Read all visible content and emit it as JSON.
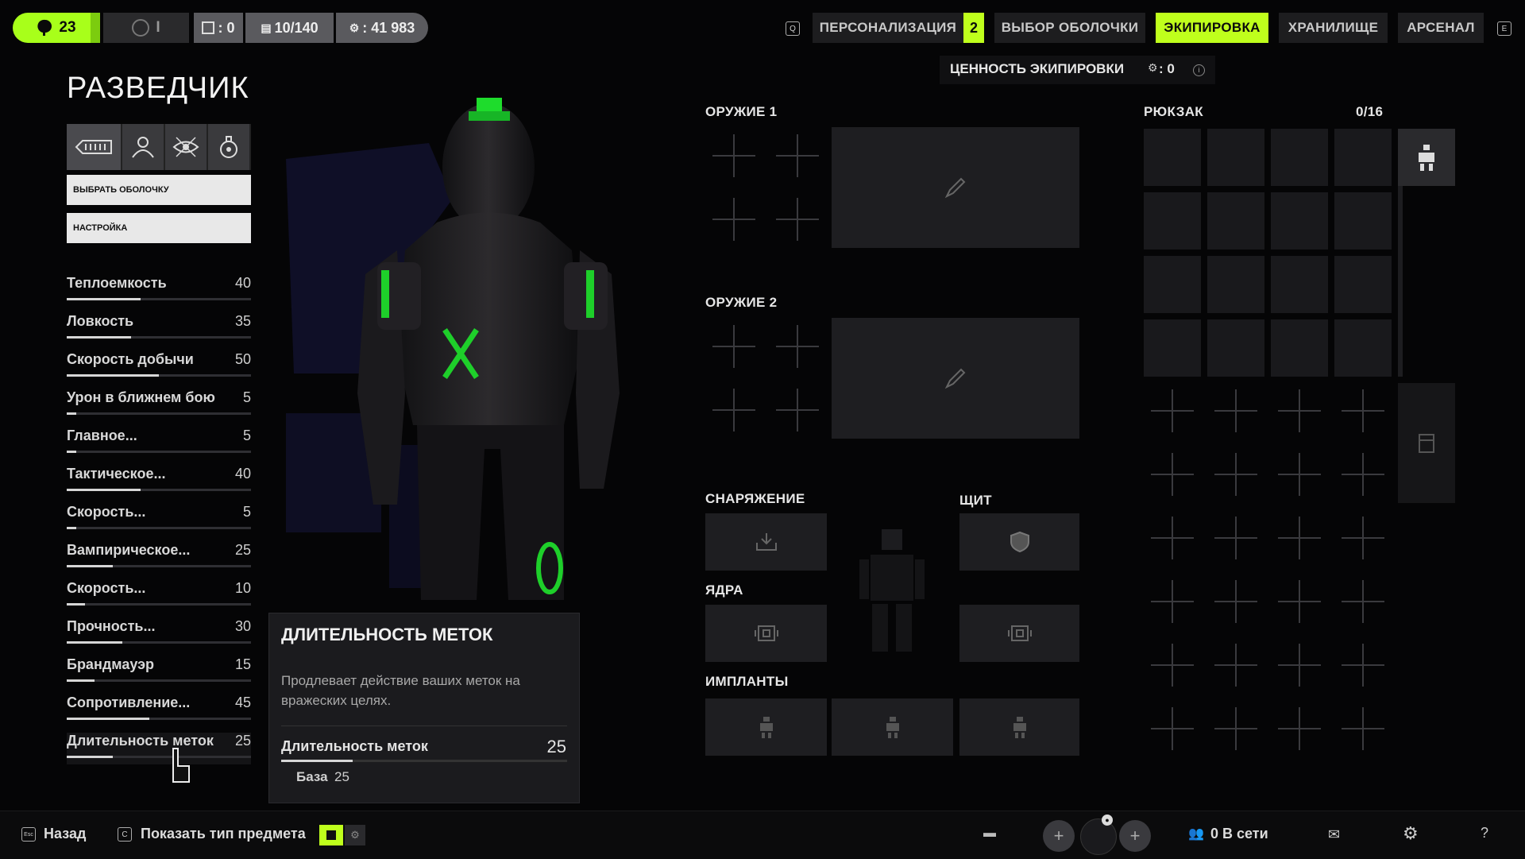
{
  "topbar": {
    "level": "23",
    "counter_2": "I",
    "currency_1": ": 0",
    "currency_2": "10/140",
    "currency_3": ": 41 983",
    "tabs": [
      {
        "label": "ПЕРСОНАЛИЗАЦИЯ",
        "active": false
      },
      {
        "label": "ВЫБОР ОБОЛОЧКИ",
        "active": false
      },
      {
        "label": "ЭКИПИРОВКА",
        "active": true
      },
      {
        "label": "ХРАНИЛИЩЕ",
        "active": false
      },
      {
        "label": "АРСЕНАЛ",
        "active": false
      }
    ],
    "personalization_badge": "2",
    "key_left": "Q",
    "key_right": "E",
    "accent": "#bfff1c"
  },
  "character": {
    "name": "РАЗВЕДЧИК",
    "select_shell_button": "ВЫБРАТЬ ОБОЛОЧКУ",
    "settings_button": "НАСТРОЙКА",
    "ability_icons": [
      "weapon-icon",
      "squad-icon",
      "recon-eye-icon",
      "grenade-icon"
    ]
  },
  "stats": [
    {
      "name": "Теплоемкость",
      "value": "40",
      "fraction": 0.4
    },
    {
      "name": "Ловкость",
      "value": "35",
      "fraction": 0.35
    },
    {
      "name": "Скорость добычи",
      "value": "50",
      "fraction": 0.5
    },
    {
      "name": "Урон в ближнем бою",
      "value": "5",
      "fraction": 0.05
    },
    {
      "name": "Главное...",
      "value": "5",
      "fraction": 0.05
    },
    {
      "name": "Тактическое...",
      "value": "40",
      "fraction": 0.4
    },
    {
      "name": "Скорость...",
      "value": "5",
      "fraction": 0.05
    },
    {
      "name": "Вампирическое...",
      "value": "25",
      "fraction": 0.25
    },
    {
      "name": "Скорость...",
      "value": "10",
      "fraction": 0.1
    },
    {
      "name": "Прочность...",
      "value": "30",
      "fraction": 0.3
    },
    {
      "name": "Брандмауэр",
      "value": "15",
      "fraction": 0.15
    },
    {
      "name": "Сопротивление...",
      "value": "45",
      "fraction": 0.45
    },
    {
      "name": "Длительность меток",
      "value": "25",
      "fraction": 0.25
    }
  ],
  "tooltip": {
    "title": "ДЛИТЕЛЬНОСТЬ МЕТОК",
    "description": "Продлевает действие ваших меток на вражеских целях.",
    "stat_name": "Длительность меток",
    "stat_value": "25",
    "base_label": "База",
    "base_value": "25",
    "fraction": 0.25
  },
  "equipment": {
    "value_label": "ЦЕННОСТЬ ЭКИПИРОВКИ",
    "value": ": 0",
    "weapon1": "ОРУЖИЕ 1",
    "weapon2": "ОРУЖИЕ 2",
    "gear": "СНАРЯЖЕНИЕ",
    "shield": "ЩИТ",
    "cores": "ЯДРА",
    "implants": "ИМПЛАНТЫ"
  },
  "backpack": {
    "label": "РЮКЗАК",
    "capacity": "0/16"
  },
  "bottombar": {
    "back_key": "Esc",
    "back_label": "Назад",
    "show_type_key": "C",
    "show_type_label": "Показать тип предмета",
    "online_label": "0 В сети"
  }
}
